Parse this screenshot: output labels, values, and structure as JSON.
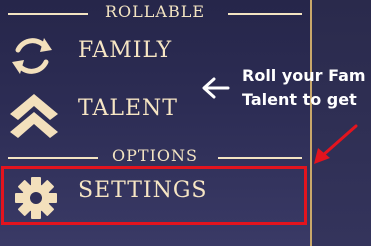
{
  "menu": {
    "rollable_heading": "ROLLABLE",
    "options_heading": "OPTIONS",
    "items": [
      {
        "label": "FAMILY",
        "icon": "refresh-icon"
      },
      {
        "label": "TALENT",
        "icon": "double-chevron-up-icon"
      },
      {
        "label": "SETTINGS",
        "icon": "gear-icon"
      }
    ]
  },
  "hint": {
    "line1": "Roll your Fam",
    "line2": "Talent to get"
  },
  "colors": {
    "text": "#f7e6c4",
    "highlight": "#e3141e",
    "accent_border": "#c9a86a"
  }
}
